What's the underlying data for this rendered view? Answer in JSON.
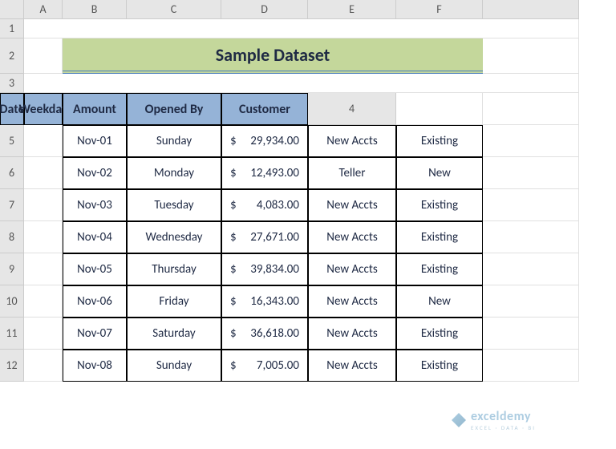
{
  "columns": [
    "A",
    "B",
    "C",
    "D",
    "E",
    "F"
  ],
  "rows": [
    "1",
    "2",
    "3",
    "4",
    "5",
    "6",
    "7",
    "8",
    "9",
    "10",
    "11",
    "12"
  ],
  "title": "Sample Dataset",
  "headers": {
    "date": "Date",
    "weekday": "Weekday",
    "amount": "Amount",
    "opened_by": "Opened By",
    "customer": "Customer"
  },
  "currency": "$",
  "data": [
    {
      "date": "Nov-01",
      "weekday": "Sunday",
      "amount": "29,934.00",
      "opened_by": "New Accts",
      "customer": "Existing"
    },
    {
      "date": "Nov-02",
      "weekday": "Monday",
      "amount": "12,493.00",
      "opened_by": "Teller",
      "customer": "New"
    },
    {
      "date": "Nov-03",
      "weekday": "Tuesday",
      "amount": "4,083.00",
      "opened_by": "New Accts",
      "customer": "Existing"
    },
    {
      "date": "Nov-04",
      "weekday": "Wednesday",
      "amount": "27,671.00",
      "opened_by": "New Accts",
      "customer": "Existing"
    },
    {
      "date": "Nov-05",
      "weekday": "Thursday",
      "amount": "39,834.00",
      "opened_by": "New Accts",
      "customer": "Existing"
    },
    {
      "date": "Nov-06",
      "weekday": "Friday",
      "amount": "16,343.00",
      "opened_by": "New Accts",
      "customer": "New"
    },
    {
      "date": "Nov-07",
      "weekday": "Saturday",
      "amount": "36,618.00",
      "opened_by": "New Accts",
      "customer": "Existing"
    },
    {
      "date": "Nov-08",
      "weekday": "Sunday",
      "amount": "7,005.00",
      "opened_by": "New Accts",
      "customer": "Existing"
    }
  ],
  "watermark": {
    "brand": "exceldemy",
    "sub": "EXCEL · DATA · BI"
  }
}
